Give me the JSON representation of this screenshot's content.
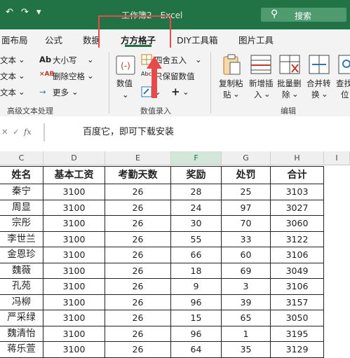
{
  "titlebar": {
    "title": "工作簿2 - Excel",
    "search_label": "搜索"
  },
  "tabs": [
    "面布局",
    "公式",
    "数据",
    "方方格子",
    "DIY工具箱",
    "图片工具"
  ],
  "ribbon": {
    "left_items": [
      "文本",
      "文本",
      "文本"
    ],
    "big_small": "大小写",
    "delete_space": "删除空格",
    "more": "更多",
    "group_text": "高级文本处理",
    "numeric": "数值",
    "round": "四舍五入",
    "keep_value": "只保留数值",
    "group_numeric": "数值录入",
    "copy_paste_1": "复制粘",
    "copy_paste_2": "贴",
    "insert_new_1": "新增插",
    "insert_new_2": "入",
    "batch_del_1": "批量删",
    "batch_del_2": "除",
    "merge_1": "合并转",
    "merge_2": "换",
    "find_1": "查找",
    "find_2": "位",
    "group_edit": "编辑"
  },
  "formula_bar": {
    "fx": "fx",
    "content": "百度它，即可下载安装"
  },
  "columns": [
    "C",
    "D",
    "E",
    "F",
    "G",
    "H",
    "I"
  ],
  "table": {
    "headers": [
      "姓名",
      "基本工资",
      "考勤天数",
      "奖励",
      "处罚",
      "合计"
    ],
    "rows": [
      [
        "秦宁",
        "3100",
        "26",
        "28",
        "25",
        "3103"
      ],
      [
        "周显",
        "3100",
        "26",
        "24",
        "97",
        "3027"
      ],
      [
        "宗彤",
        "3100",
        "26",
        "30",
        "70",
        "3060"
      ],
      [
        "李世兰",
        "3100",
        "26",
        "55",
        "33",
        "3122"
      ],
      [
        "金恩珍",
        "3100",
        "26",
        "66",
        "60",
        "3106"
      ],
      [
        "魏薇",
        "3100",
        "26",
        "18",
        "69",
        "3049"
      ],
      [
        "孔苑",
        "3100",
        "26",
        "9",
        "3",
        "3106"
      ],
      [
        "冯柳",
        "3100",
        "26",
        "96",
        "39",
        "3157"
      ],
      [
        "严采绿",
        "3100",
        "26",
        "15",
        "65",
        "3050"
      ],
      [
        "魏清怡",
        "3100",
        "26",
        "96",
        "1",
        "3195"
      ],
      [
        "蒋乐萱",
        "3100",
        "26",
        "64",
        "35",
        "3129"
      ]
    ]
  }
}
